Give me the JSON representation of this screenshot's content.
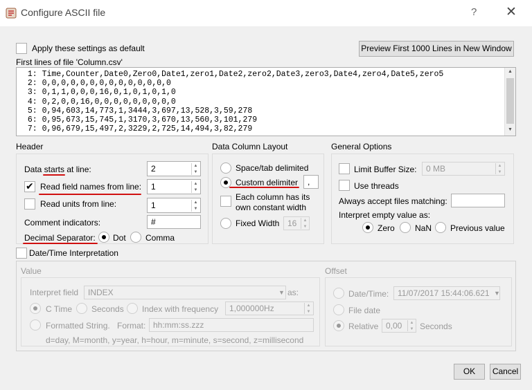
{
  "window": {
    "title": "Configure ASCII file",
    "help_label": "?",
    "close_label": "✕"
  },
  "top": {
    "apply_default_label": "Apply these settings as default",
    "preview_button_label": "Preview First 1000 Lines in New Window",
    "first_lines_label": "First lines of file 'Column.csv'"
  },
  "preview_lines": [
    " 1: Time,Counter,Date0,Zero0,Date1,zero1,Date2,zero2,Date3,zero3,Date4,zero4,Date5,zero5",
    " 2: 0,0,0,0,0,0,0,0,0,0,0,0,0,0",
    " 3: 0,1,1,0,0,0,16,0,1,0,1,0,1,0",
    " 4: 0,2,0,0,16,0,0,0,0,0,0,0,0,0",
    " 5: 0,94,603,14,773,1,3444,3,697,13,528,3,59,278",
    " 6: 0,95,673,15,745,1,3170,3,670,13,560,3,101,279",
    " 7: 0,96,679,15,497,2,3229,2,725,14,494,3,82,279"
  ],
  "header": {
    "title": "Header",
    "data_starts_label": "Data starts at line:",
    "data_starts_value": "2",
    "read_field_names_label": "Read field names from line:",
    "read_field_names_value": "1",
    "read_field_names_checked": true,
    "read_units_label": "Read units from line:",
    "read_units_value": "1",
    "comment_label": "Comment indicators:",
    "comment_value": "#",
    "decimal_label": "Decimal Separator:",
    "decimal_dot": "Dot",
    "decimal_comma": "Comma",
    "decimal_selected": "Dot"
  },
  "layout": {
    "title": "Data Column Layout",
    "space_tab": "Space/tab delimited",
    "custom": "Custom delimiter",
    "custom_value": ",",
    "each_column_line1": "Each column has its",
    "each_column_line2": "own constant width",
    "fixed_width": "Fixed Width",
    "fixed_width_value": "16",
    "selected": "custom"
  },
  "general": {
    "title": "General Options",
    "limit_buffer": "Limit Buffer Size:",
    "limit_buffer_value": "0 MB",
    "use_threads": "Use threads",
    "always_accept": "Always accept files matching:",
    "always_accept_value": "",
    "interpret_empty": "Interpret empty value as:",
    "zero": "Zero",
    "nan": "NaN",
    "previous": "Previous value",
    "selected": "Zero"
  },
  "datetime": {
    "title": "Date/Time Interpretation",
    "value_group": "Value",
    "interpret_field_label": "Interpret field",
    "interpret_field_value": "INDEX",
    "as_label": "as:",
    "c_time": "C Time",
    "seconds": "Seconds",
    "index_freq": "Index with frequency",
    "freq_value": "1,000000Hz",
    "formatted": "Formatted String.",
    "format_label": "Format:",
    "format_value": "hh:mm:ss.zzz",
    "format_hint": "d=day, M=month, y=year, h=hour, m=minute, s=second, z=millisecond",
    "offset_group": "Offset",
    "date_time_label": "Date/Time:",
    "date_time_value": "11/07/2017 15:44:06.621",
    "file_date": "File date",
    "relative": "Relative",
    "relative_value": "0,00",
    "seconds_unit": "Seconds"
  },
  "footer": {
    "ok_label": "OK",
    "cancel_label": "Cancel"
  },
  "colors": {
    "annotation_red": "#d01010",
    "window_bg": "#f0f0f0"
  }
}
